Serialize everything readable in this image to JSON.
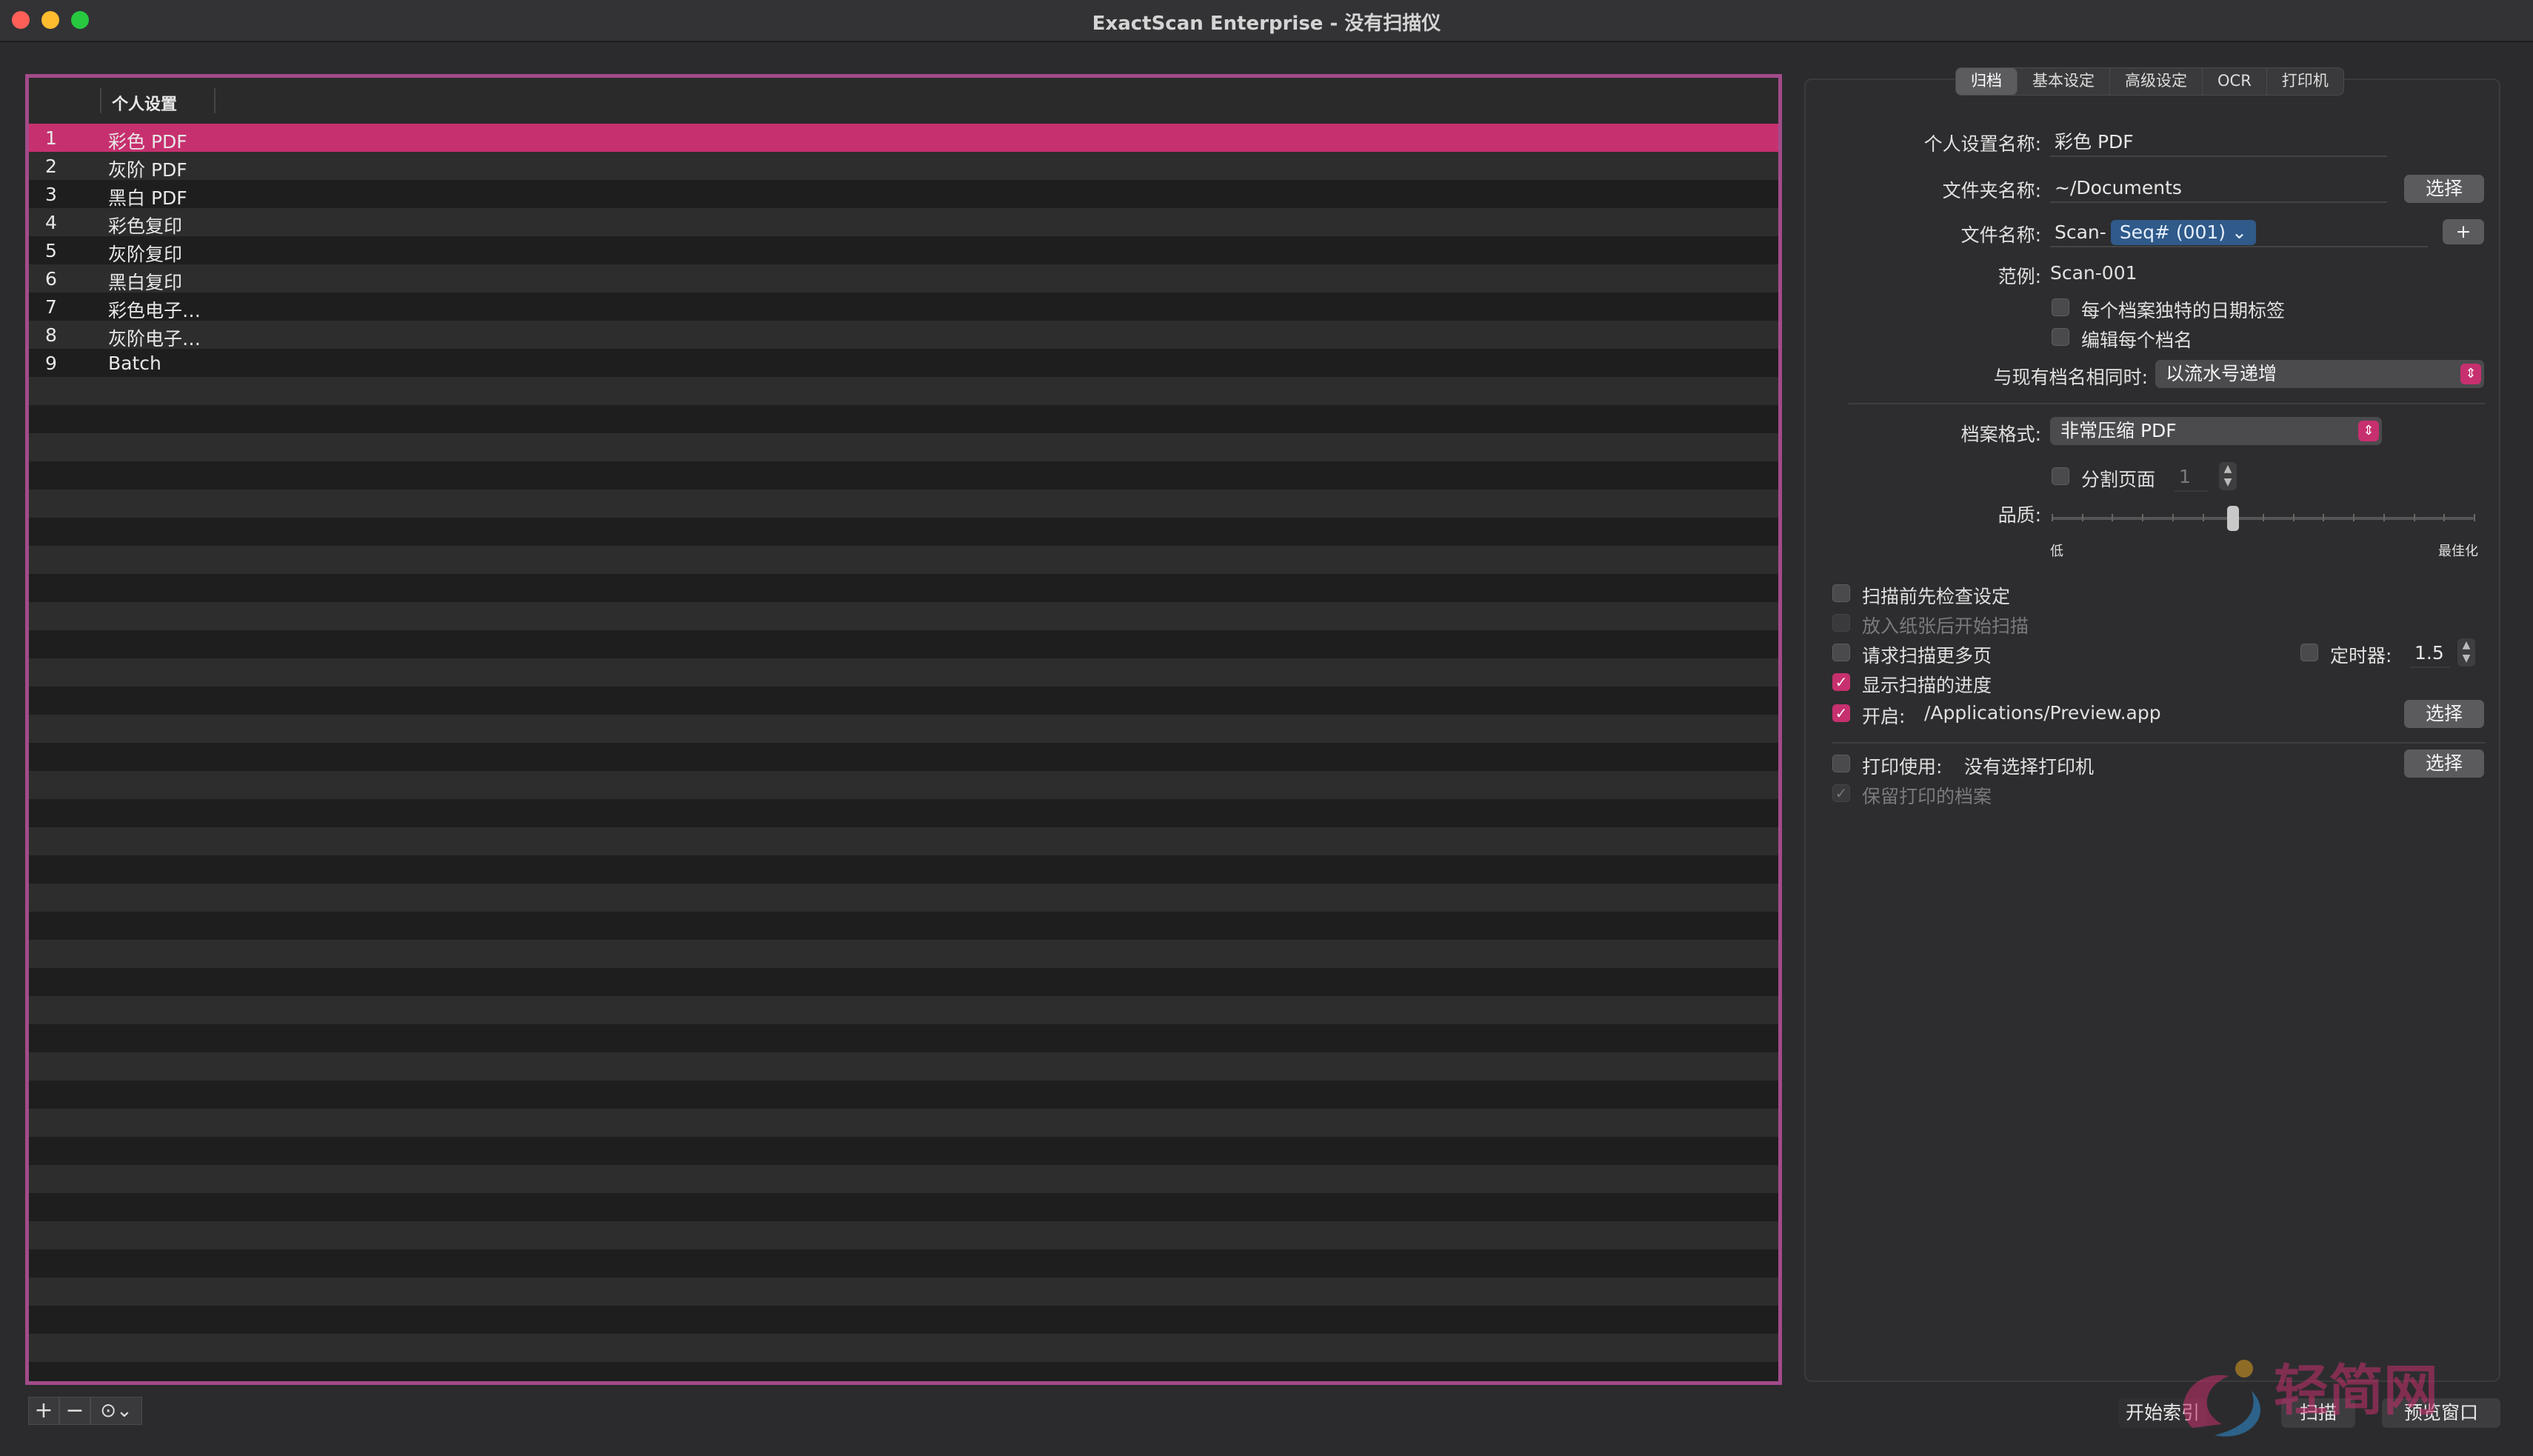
{
  "window": {
    "title": "ExactScan Enterprise - 没有扫描仪"
  },
  "profiles": {
    "column_header": "个人设置",
    "rows": [
      {
        "num": "1",
        "name": "彩色 PDF",
        "selected": true
      },
      {
        "num": "2",
        "name": "灰阶 PDF"
      },
      {
        "num": "3",
        "name": "黑白 PDF"
      },
      {
        "num": "4",
        "name": "彩色复印"
      },
      {
        "num": "5",
        "name": "灰阶复印"
      },
      {
        "num": "6",
        "name": "黑白复印"
      },
      {
        "num": "7",
        "name": "彩色电子…"
      },
      {
        "num": "8",
        "name": "灰阶电子…"
      },
      {
        "num": "9",
        "name": "Batch"
      }
    ],
    "tools": {
      "add": "+",
      "remove": "−",
      "more": "⊙⌄"
    }
  },
  "tabs": [
    "归档",
    "基本设定",
    "高级设定",
    "OCR",
    "打印机"
  ],
  "archive": {
    "profile_name_label": "个人设置名称:",
    "profile_name_value": "彩色 PDF",
    "folder_label": "文件夹名称:",
    "folder_value": "~/Documents",
    "choose": "选择",
    "filename_label": "文件名称:",
    "filename_prefix": "Scan-",
    "filename_token": "Seq# (001) ⌄",
    "add_btn": "+",
    "example_label": "范例:",
    "example_value": "Scan-001",
    "unique_date_label": "每个档案独特的日期标签",
    "edit_each_label": "编辑每个档名",
    "conflict_label": "与现有档名相同时:",
    "conflict_value": "以流水号递增",
    "format_label": "档案格式:",
    "format_value": "非常压缩 PDF",
    "split_label": "分割页面",
    "split_value": "1",
    "quality_label": "品质:",
    "quality_low": "低",
    "quality_high": "最佳化",
    "quality_level": 0.43
  },
  "options": {
    "check_before_scan": "扫描前先检查设定",
    "start_on_paper": "放入纸张后开始扫描",
    "ask_more": "请求扫描更多页",
    "timer_label": "定时器:",
    "timer_value": "1.5",
    "show_progress": "显示扫描的进度",
    "open_label": "开启:",
    "open_value": "/Applications/Preview.app",
    "print_label": "打印使用:",
    "print_value": "没有选择打印机",
    "keep_print": "保留打印的档案"
  },
  "footer": {
    "start_index": "开始索引",
    "scan": "扫描",
    "preview": "预览窗口"
  },
  "watermark": {
    "text": "轻简网"
  },
  "colors": {
    "accent": "#c7306e",
    "frame": "#a24b8a"
  }
}
